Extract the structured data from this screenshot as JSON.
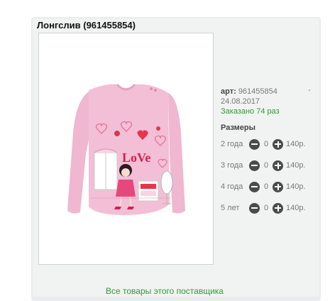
{
  "product": {
    "title": "Лонгслив (961455854)",
    "art_label": "арт:",
    "art_value": "961455854",
    "tick_mark": "'",
    "date": "24.08.2017",
    "ordered": "Заказано 74 раз",
    "sizes_header": "Размеры",
    "image_alt": "Лонгслив",
    "print_text": "LoVe"
  },
  "sizes": [
    {
      "label": "2 года",
      "qty": "0",
      "price": "140р."
    },
    {
      "label": "3 года",
      "qty": "0",
      "price": "140р."
    },
    {
      "label": "4 года",
      "qty": "0",
      "price": "140р."
    },
    {
      "label": "5 лет",
      "qty": "0",
      "price": "140р."
    }
  ],
  "footer": {
    "supplier_link": "Все товары этого поставщика"
  },
  "colors": {
    "link_green": "#2e9c2e",
    "shirt_pink": "#f2bfd6",
    "panel_bg": "#f1f3f3"
  },
  "icons": {
    "minus": "minus-circle-icon",
    "plus": "plus-circle-icon"
  }
}
